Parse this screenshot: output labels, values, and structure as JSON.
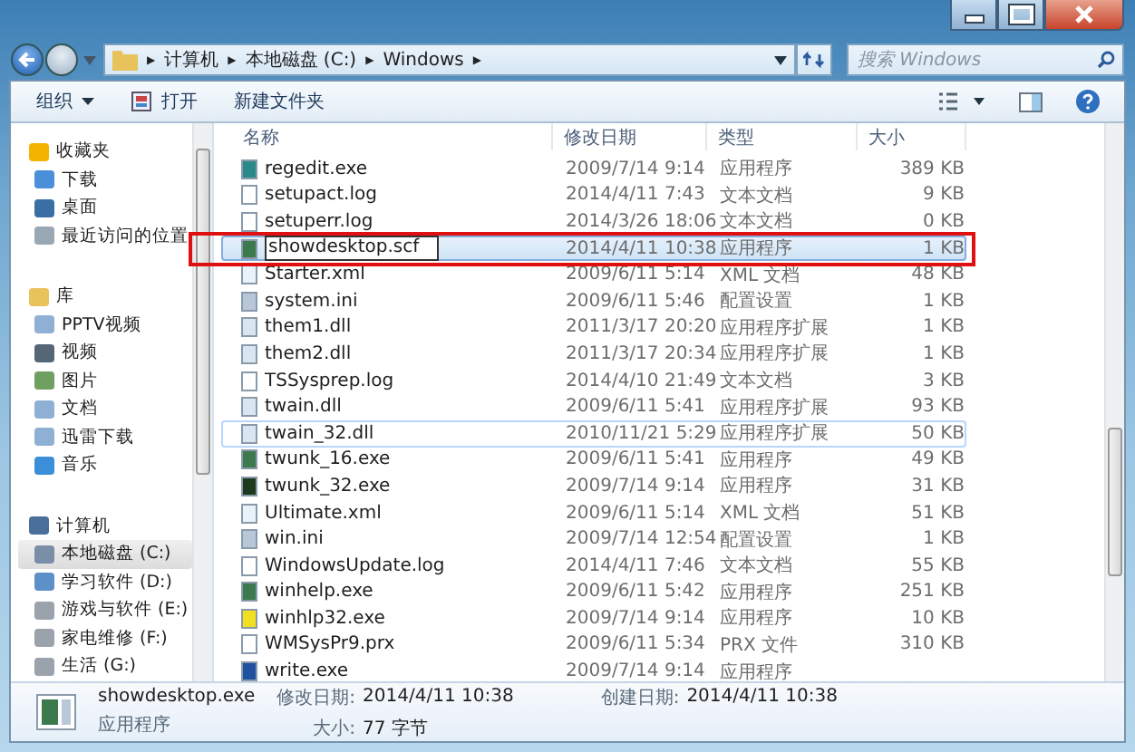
{
  "address": {
    "crumbs": [
      "计算机",
      "本地磁盘 (C:)",
      "Windows"
    ],
    "separator": "▶"
  },
  "search": {
    "placeholder": "搜索 Windows"
  },
  "toolbar": {
    "buttons": [
      {
        "label": "组织",
        "kind": "menu"
      },
      {
        "label": "打开",
        "kind": "open"
      },
      {
        "label": "新建文件夹",
        "kind": "plain"
      }
    ]
  },
  "navigation": [
    {
      "label": "收藏夹",
      "kind": "star",
      "selected": false,
      "children": [
        {
          "label": "下载",
          "kind": "download",
          "selected": false
        },
        {
          "label": "桌面",
          "kind": "desktop",
          "selected": false
        },
        {
          "label": "最近访问的位置",
          "kind": "recent",
          "selected": false
        }
      ]
    },
    {
      "label": "库",
      "kind": "library",
      "selected": false,
      "children": [
        {
          "label": "PPTV视频",
          "kind": "doc",
          "selected": false
        },
        {
          "label": "视频",
          "kind": "video",
          "selected": false
        },
        {
          "label": "图片",
          "kind": "picture",
          "selected": false
        },
        {
          "label": "文档",
          "kind": "doc",
          "selected": false
        },
        {
          "label": "迅雷下载",
          "kind": "doc",
          "selected": false
        },
        {
          "label": "音乐",
          "kind": "music",
          "selected": false
        }
      ]
    },
    {
      "label": "计算机",
      "kind": "computer",
      "selected": false,
      "children": [
        {
          "label": "本地磁盘 (C:)",
          "kind": "system-drive",
          "selected": true
        },
        {
          "label": "学习软件 (D:)",
          "kind": "network-drive",
          "selected": false
        },
        {
          "label": "游戏与软件 (E:)",
          "kind": "drive",
          "selected": false
        },
        {
          "label": "家电维修 (F:)",
          "kind": "drive",
          "selected": false
        },
        {
          "label": "生活 (G:)",
          "kind": "drive",
          "selected": false
        }
      ]
    }
  ],
  "files": {
    "columns": [
      "名称",
      "修改日期",
      "类型",
      "大小"
    ],
    "rows": [
      {
        "name": "regedit.exe",
        "date": "2009/7/14 9:14",
        "type": "应用程序",
        "size": "389 KB",
        "kind": "registry",
        "selected": false,
        "renaming": false,
        "hovered": false,
        "annotated": false
      },
      {
        "name": "setupact.log",
        "date": "2014/4/11 7:43",
        "type": "文本文档",
        "size": "9 KB",
        "kind": "text",
        "selected": false,
        "renaming": false,
        "hovered": false,
        "annotated": false
      },
      {
        "name": "setuperr.log",
        "date": "2014/3/26 18:06",
        "type": "文本文档",
        "size": "0 KB",
        "kind": "text",
        "selected": false,
        "renaming": false,
        "hovered": false,
        "annotated": false
      },
      {
        "name": "showdesktop.scf",
        "date": "2014/4/11 10:38",
        "type": "应用程序",
        "size": "1 KB",
        "kind": "app",
        "selected": true,
        "renaming": true,
        "hovered": false,
        "annotated": true
      },
      {
        "name": "Starter.xml",
        "date": "2009/6/11 5:14",
        "type": "XML 文档",
        "size": "48 KB",
        "kind": "xml",
        "selected": false,
        "renaming": false,
        "hovered": false,
        "annotated": false
      },
      {
        "name": "system.ini",
        "date": "2009/6/11 5:46",
        "type": "配置设置",
        "size": "1 KB",
        "kind": "settings",
        "selected": false,
        "renaming": false,
        "hovered": false,
        "annotated": false
      },
      {
        "name": "them1.dll",
        "date": "2011/3/17 20:20",
        "type": "应用程序扩展",
        "size": "1 KB",
        "kind": "dll",
        "selected": false,
        "renaming": false,
        "hovered": false,
        "annotated": false
      },
      {
        "name": "them2.dll",
        "date": "2011/3/17 20:34",
        "type": "应用程序扩展",
        "size": "1 KB",
        "kind": "dll",
        "selected": false,
        "renaming": false,
        "hovered": false,
        "annotated": false
      },
      {
        "name": "TSSysprep.log",
        "date": "2014/4/10 21:49",
        "type": "文本文档",
        "size": "3 KB",
        "kind": "text",
        "selected": false,
        "renaming": false,
        "hovered": false,
        "annotated": false
      },
      {
        "name": "twain.dll",
        "date": "2009/6/11 5:41",
        "type": "应用程序扩展",
        "size": "93 KB",
        "kind": "dll",
        "selected": false,
        "renaming": false,
        "hovered": false,
        "annotated": false
      },
      {
        "name": "twain_32.dll",
        "date": "2010/11/21 5:29",
        "type": "应用程序扩展",
        "size": "50 KB",
        "kind": "dll",
        "selected": false,
        "renaming": false,
        "hovered": true,
        "annotated": false
      },
      {
        "name": "twunk_16.exe",
        "date": "2009/6/11 5:41",
        "type": "应用程序",
        "size": "49 KB",
        "kind": "app",
        "selected": false,
        "renaming": false,
        "hovered": false,
        "annotated": false
      },
      {
        "name": "twunk_32.exe",
        "date": "2009/7/14 9:14",
        "type": "应用程序",
        "size": "31 KB",
        "kind": "scanner",
        "selected": false,
        "renaming": false,
        "hovered": false,
        "annotated": false
      },
      {
        "name": "Ultimate.xml",
        "date": "2009/6/11 5:14",
        "type": "XML 文档",
        "size": "51 KB",
        "kind": "xml",
        "selected": false,
        "renaming": false,
        "hovered": false,
        "annotated": false
      },
      {
        "name": "win.ini",
        "date": "2009/7/14 12:54",
        "type": "配置设置",
        "size": "1 KB",
        "kind": "settings",
        "selected": false,
        "renaming": false,
        "hovered": false,
        "annotated": false
      },
      {
        "name": "WindowsUpdate.log",
        "date": "2014/4/11 7:46",
        "type": "文本文档",
        "size": "55 KB",
        "kind": "text",
        "selected": false,
        "renaming": false,
        "hovered": false,
        "annotated": false
      },
      {
        "name": "winhelp.exe",
        "date": "2009/6/11 5:42",
        "type": "应用程序",
        "size": "251 KB",
        "kind": "app",
        "selected": false,
        "renaming": false,
        "hovered": false,
        "annotated": false
      },
      {
        "name": "winhlp32.exe",
        "date": "2009/7/14 9:14",
        "type": "应用程序",
        "size": "10 KB",
        "kind": "help",
        "selected": false,
        "renaming": false,
        "hovered": false,
        "annotated": false
      },
      {
        "name": "WMSysPr9.prx",
        "date": "2009/6/11 5:34",
        "type": "PRX 文件",
        "size": "310 KB",
        "kind": "text",
        "selected": false,
        "renaming": false,
        "hovered": false,
        "annotated": false
      },
      {
        "name": "write.exe",
        "date": "2009/7/14 9:14",
        "type": "应用程序",
        "kind": "write",
        "selected": false,
        "renaming": false,
        "hovered": false,
        "annotated": false
      }
    ]
  },
  "details": {
    "name": "showdesktop.exe",
    "type": "应用程序",
    "fields": [
      {
        "label": "修改日期:",
        "value": "2014/4/11 10:38"
      },
      {
        "label": "大小:",
        "value": "77 字节"
      },
      {
        "label": "创建日期:",
        "value": "2014/4/11 10:38"
      }
    ]
  }
}
